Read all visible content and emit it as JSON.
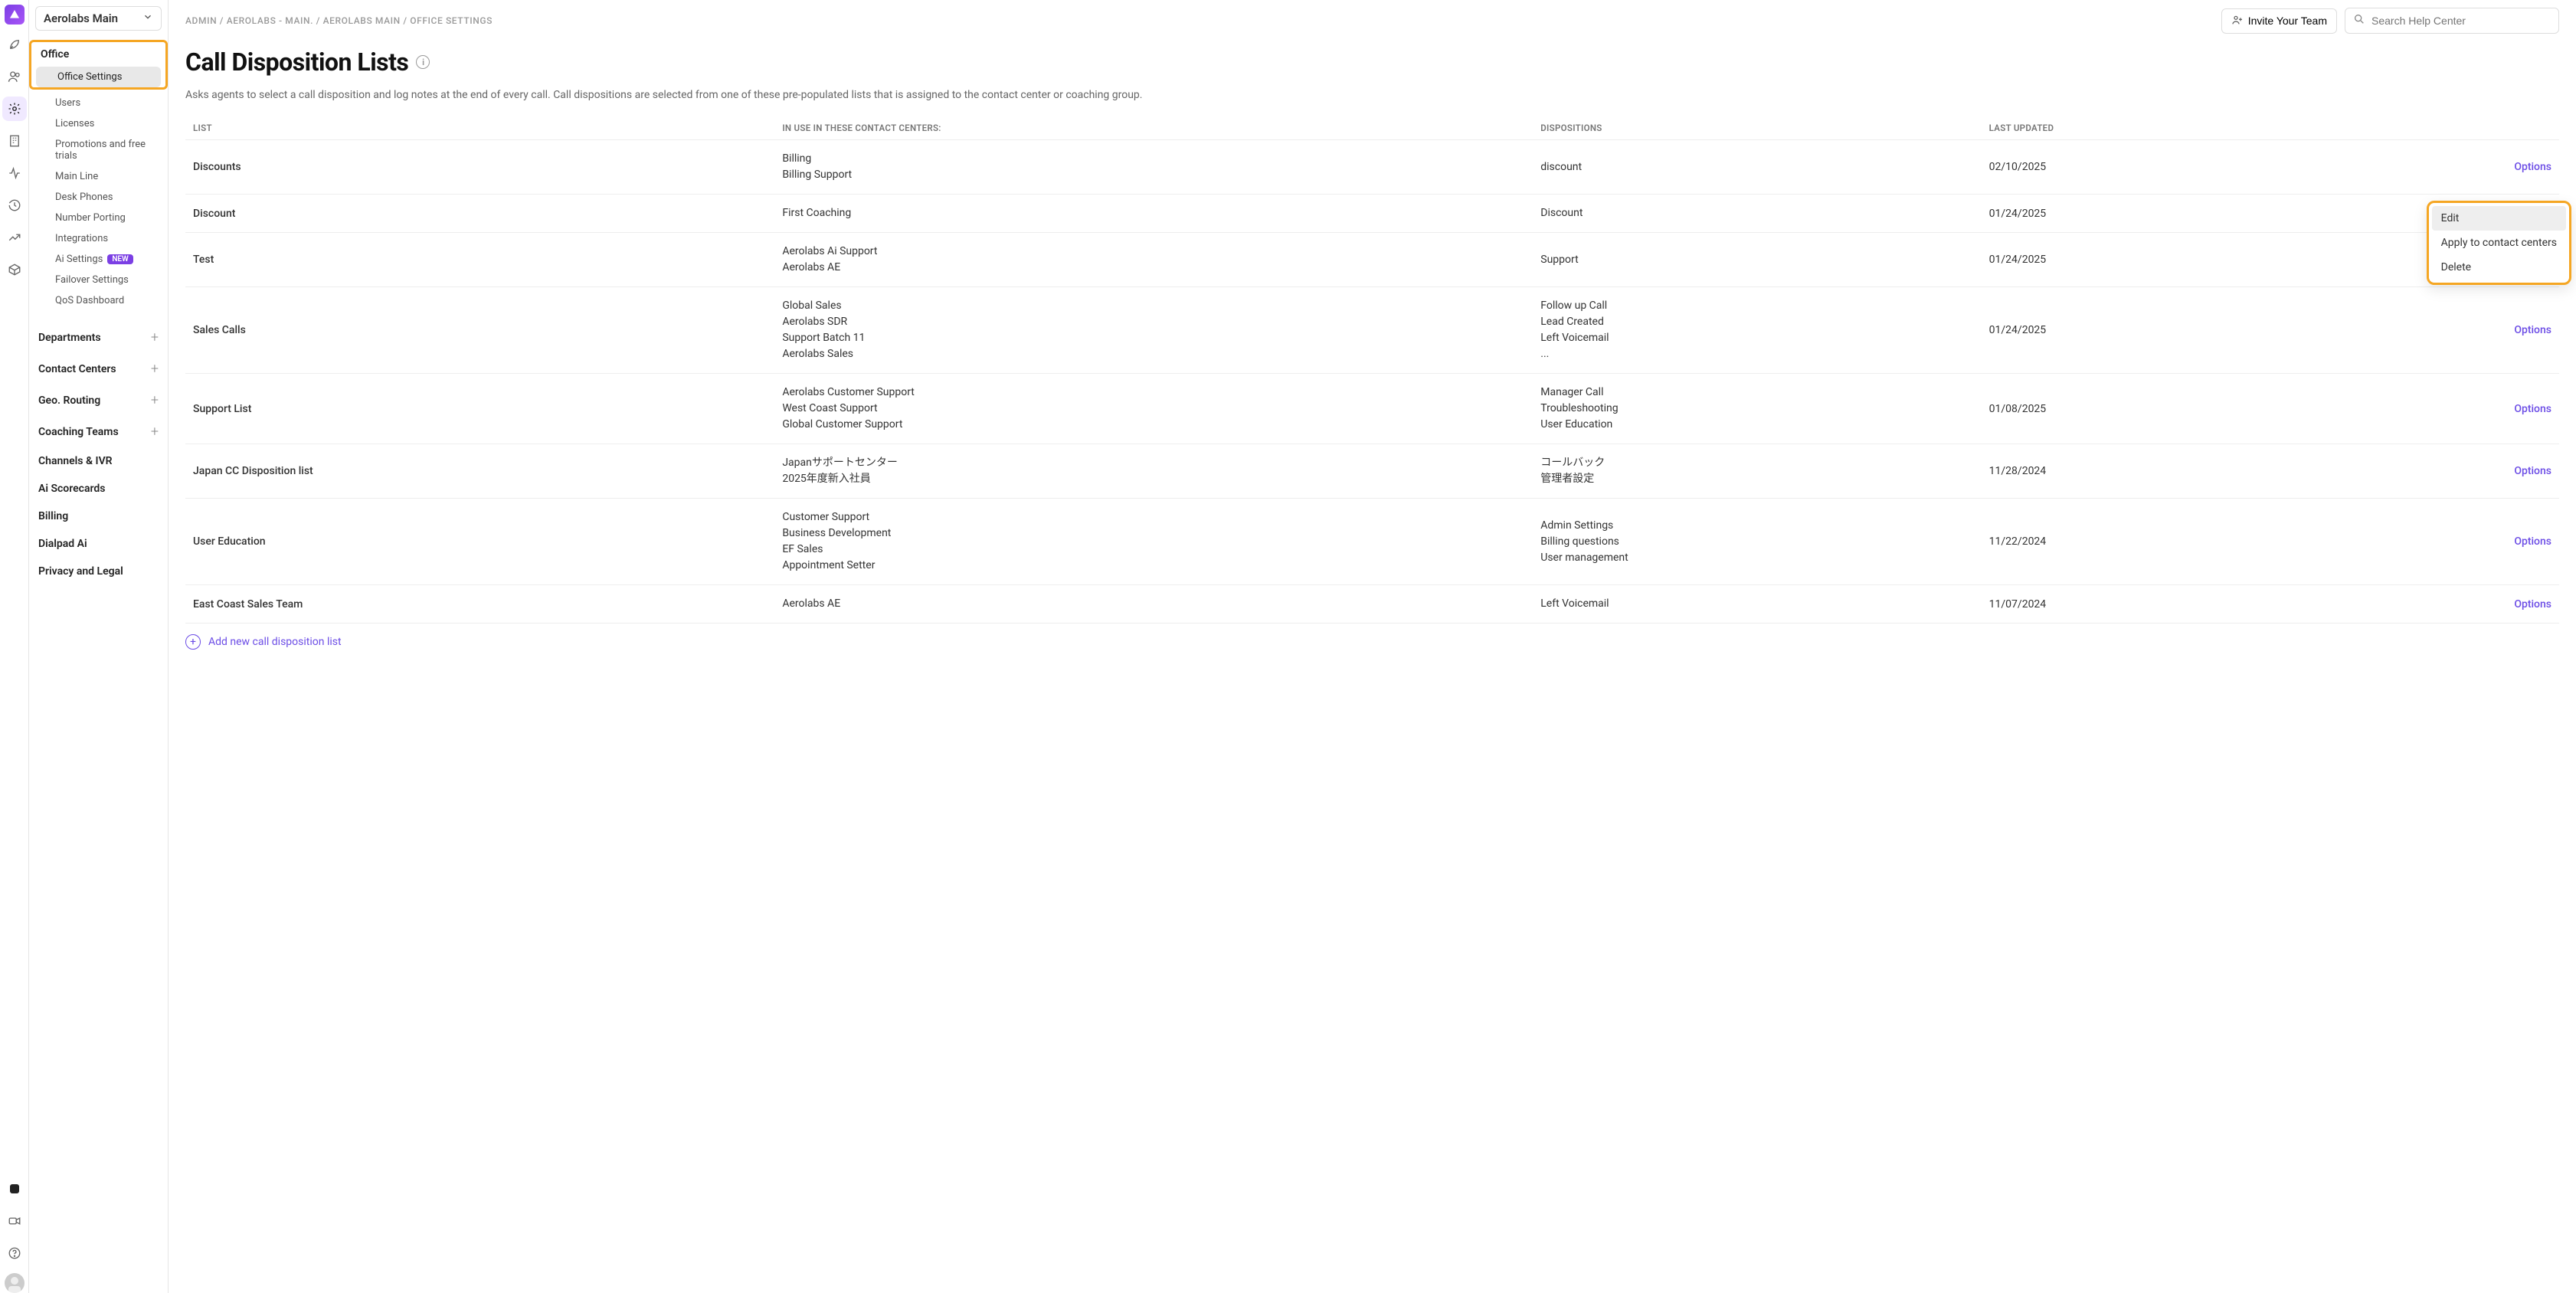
{
  "workspace": {
    "name": "Aerolabs Main"
  },
  "breadcrumb": {
    "admin": "ADMIN",
    "org": "AEROLABS - MAIN.",
    "workspace": "AEROLABS MAIN",
    "page": "OFFICE SETTINGS",
    "sep": "/"
  },
  "header": {
    "invite_label": "Invite Your Team",
    "search_placeholder": "Search Help Center"
  },
  "sidebar": {
    "office": {
      "label": "Office",
      "items": [
        {
          "label": "Office Settings",
          "active": true
        },
        {
          "label": "Users"
        },
        {
          "label": "Licenses"
        },
        {
          "label": "Promotions and free trials"
        },
        {
          "label": "Main Line"
        },
        {
          "label": "Desk Phones"
        },
        {
          "label": "Number Porting"
        },
        {
          "label": "Integrations"
        },
        {
          "label": "Ai Settings",
          "badge": "NEW"
        },
        {
          "label": "Failover Settings"
        },
        {
          "label": "QoS Dashboard"
        }
      ]
    },
    "sections": [
      {
        "label": "Departments",
        "add": true
      },
      {
        "label": "Contact Centers",
        "add": true
      },
      {
        "label": "Geo. Routing",
        "add": true
      },
      {
        "label": "Coaching Teams",
        "add": true
      },
      {
        "label": "Channels & IVR"
      },
      {
        "label": "Ai Scorecards"
      },
      {
        "label": "Billing"
      },
      {
        "label": "Dialpad Ai"
      },
      {
        "label": "Privacy and Legal"
      }
    ]
  },
  "page": {
    "title": "Call Disposition Lists",
    "description": "Asks agents to select a call disposition and log notes at the end of every call. Call dispositions are selected from one of these pre-populated lists that is assigned to the contact center or coaching group.",
    "columns": {
      "list": "LIST",
      "in_use": "IN USE IN THESE CONTACT CENTERS:",
      "dispositions": "DISPOSITIONS",
      "updated": "LAST UPDATED"
    },
    "options_label": "Options",
    "add_label": "Add new call disposition list",
    "rows": [
      {
        "name": "Discounts",
        "centers": [
          "Billing",
          "Billing Support"
        ],
        "dispositions": [
          "discount"
        ],
        "updated": "02/10/2025"
      },
      {
        "name": "Discount",
        "centers": [
          "First Coaching"
        ],
        "dispositions": [
          "Discount"
        ],
        "updated": "01/24/2025"
      },
      {
        "name": "Test",
        "centers": [
          "Aerolabs Ai Support",
          "Aerolabs AE"
        ],
        "dispositions": [
          "Support"
        ],
        "updated": "01/24/2025"
      },
      {
        "name": "Sales Calls",
        "centers": [
          "Global Sales",
          "Aerolabs SDR",
          "Support Batch 11",
          "Aerolabs Sales"
        ],
        "dispositions": [
          "Follow up Call",
          "Lead Created",
          "Left Voicemail",
          "..."
        ],
        "updated": "01/24/2025"
      },
      {
        "name": "Support List",
        "centers": [
          "Aerolabs Customer Support",
          "West Coast Support",
          "Global Customer Support"
        ],
        "dispositions": [
          "Manager Call",
          "Troubleshooting",
          "User Education"
        ],
        "updated": "01/08/2025"
      },
      {
        "name": "Japan CC Disposition list",
        "centers": [
          "Japanサポートセンター",
          "2025年度新入社員"
        ],
        "dispositions": [
          "コールバック",
          "管理者設定"
        ],
        "updated": "11/28/2024"
      },
      {
        "name": "User Education",
        "centers": [
          "Customer Support",
          "Business Development",
          "EF Sales",
          "Appointment Setter"
        ],
        "dispositions": [
          "Admin Settings",
          "Billing questions",
          "User management"
        ],
        "updated": "11/22/2024"
      },
      {
        "name": "East Coast Sales Team",
        "centers": [
          "Aerolabs AE"
        ],
        "dispositions": [
          "Left Voicemail"
        ],
        "updated": "11/07/2024"
      }
    ],
    "context_menu": {
      "edit": "Edit",
      "apply": "Apply to contact centers",
      "delete": "Delete"
    }
  }
}
